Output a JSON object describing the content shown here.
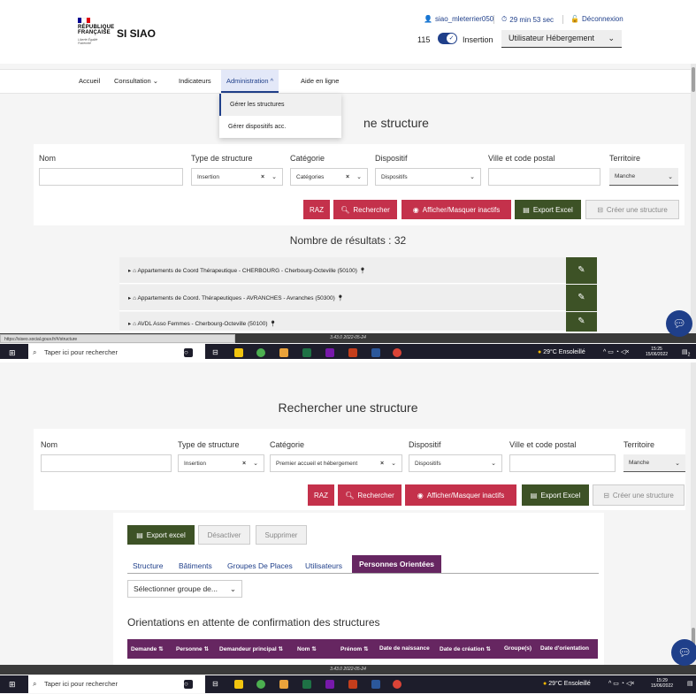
{
  "colors": {
    "primary_blue": "#1f3f8a",
    "green": "#3d5226",
    "red": "#c4314b",
    "purple": "#662661",
    "flag_blue": "#000091",
    "flag_red": "#e1000f"
  },
  "header": {
    "republic_line1": "RÉPUBLIQUE",
    "republic_line2": "FRANÇAISE",
    "motto": "Liberté Égalité Fraternité",
    "brand": "SI SIAO",
    "username": "siao_mleterrier050",
    "timer": "29 min 53 sec",
    "logout": "Déconnexion",
    "count": "115",
    "toggle_label": "Insertion",
    "role": "Utilisateur Hébergement"
  },
  "nav": {
    "items": [
      "Accueil",
      "Consultation",
      "Indicateurs",
      "Administration",
      "Aide en ligne"
    ],
    "dropdown": [
      "Gérer les structures",
      "Gérer dispositifs acc."
    ]
  },
  "search": {
    "title_partial": "ne structure",
    "title": "Rechercher une structure",
    "labels": {
      "nom": "Nom",
      "type": "Type de structure",
      "categorie": "Catégorie",
      "dispositif": "Dispositif",
      "ville": "Ville et code postal",
      "territoire": "Territoire"
    },
    "values1": {
      "type": "Insertion",
      "categorie": "Catégories",
      "dispositif": "Dispositifs",
      "territoire": "Manche"
    },
    "values2": {
      "type": "Insertion",
      "categorie": "Premier accueil et hébergement",
      "dispositif": "Dispositifs",
      "territoire": "Manche"
    },
    "buttons": {
      "raz": "RAZ",
      "search": "Rechercher",
      "toggle_inactive": "Afficher/Masquer inactifs",
      "export": "Export Excel",
      "create": "Créer une structure"
    }
  },
  "results": {
    "count_label": "Nombre de résultats : 32",
    "rows": [
      "Appartements de Coord Thérapeutique - CHERBOURG - Cherbourg-Octeville (50100)",
      "Appartements de Coord. Thérapeutiques - AVRANCHES - Avranches (50300)",
      "AVDL Asso Femmes - Cherbourg-Octeville (50100)"
    ]
  },
  "browser": {
    "url": "https://siseo.social.gouv.fr/#/structure",
    "version": "3.43.0 2022-05-24"
  },
  "taskbar": {
    "search_placeholder": "Taper ici pour rechercher",
    "weather": "29°C Ensoleillé",
    "time1": "15:25",
    "date1": "15/06/2022",
    "time2": "15:29",
    "date2": "15/06/2022",
    "notif_count": "2"
  },
  "detail": {
    "buttons": {
      "export": "Export excel",
      "deactivate": "Désactiver",
      "delete": "Supprimer"
    },
    "tabs": [
      "Structure",
      "Bâtiments",
      "Groupes De Places",
      "Utilisateurs",
      "Personnes Orientées"
    ],
    "group_select": "Sélectionner groupe de...",
    "orient_title": "Orientations en attente de confirmation des structures",
    "columns": [
      "Demande",
      "Personne",
      "Demandeur principal",
      "Nom",
      "Prénom",
      "Date de naissance",
      "Date de création",
      "Groupe(s)",
      "Date d'orientation"
    ],
    "sort_glyph": "⇅"
  }
}
